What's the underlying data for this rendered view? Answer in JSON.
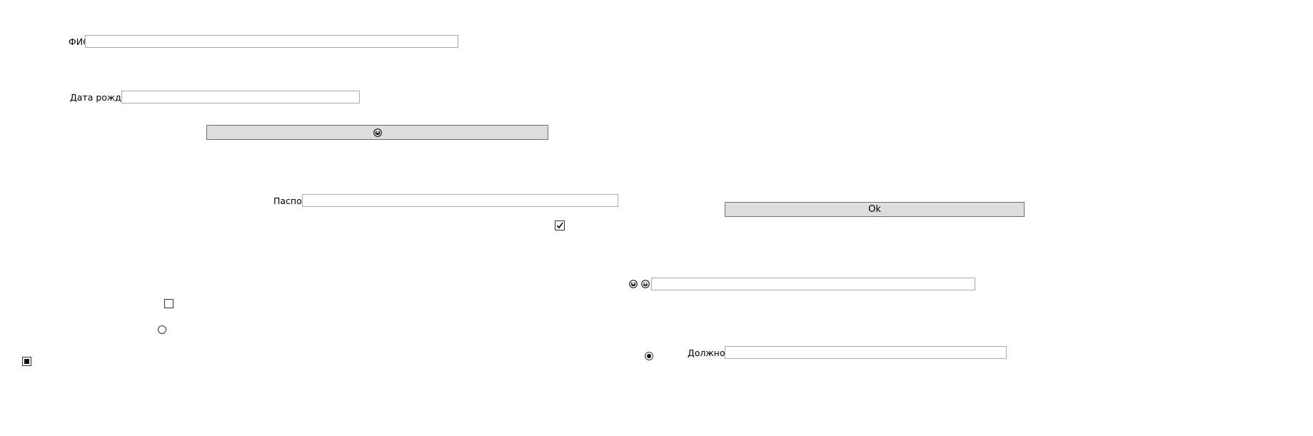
{
  "form": {
    "fio_label": "ФИО",
    "fio_value": "",
    "birthdate_label": "Дата рождения",
    "birthdate_value": "",
    "passport_label": "Паспорт",
    "passport_value": "",
    "position_label": "Должность",
    "position_value": "",
    "emoji_field_value": "",
    "ok_label": "Ok",
    "emoji_button_icon": "grinning-squint-face-icon"
  },
  "controls": {
    "checkbox_main_checked": true,
    "checkbox_left_checked": false,
    "checkbox_indeterminate_state": "indeterminate",
    "radio_left_selected": false,
    "radio_bottom_selected": true
  },
  "icons": {
    "emoji_label_first": "grinning-squint-face-icon",
    "emoji_label_second": "grinning-face-icon"
  }
}
